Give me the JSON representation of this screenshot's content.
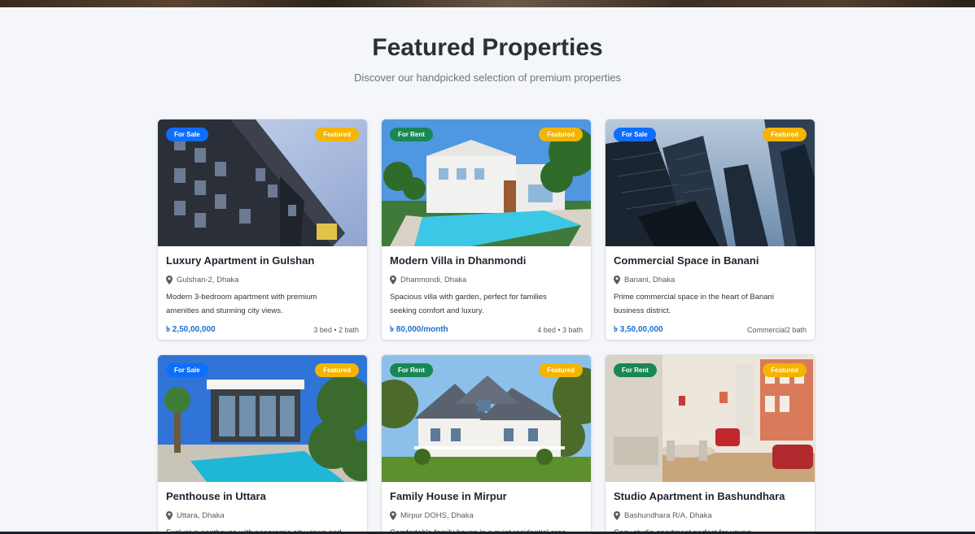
{
  "section": {
    "title": "Featured Properties",
    "subtitle": "Discover our handpicked selection of premium properties"
  },
  "colors": {
    "sale": "#0d6efd",
    "rent": "#198754",
    "featured": "#f4b400",
    "price": "#1a6fd1"
  },
  "properties": [
    {
      "type": "For Sale",
      "featured": "Featured",
      "title": "Luxury Apartment in Gulshan",
      "location": "Gulshan-2, Dhaka",
      "description_l1": "Modern 3-bedroom apartment with premium",
      "description_l2": "amenities and stunning city views.",
      "price": "৳ 2,50,00,000",
      "meta": "3 bed • 2 bath",
      "image": "apartment-building"
    },
    {
      "type": "For Rent",
      "featured": "Featured",
      "title": "Modern Villa in Dhanmondi",
      "location": "Dhanmondi, Dhaka",
      "description_l1": "Spacious villa with garden, perfect for families",
      "description_l2": "seeking comfort and luxury.",
      "price": "৳ 80,000/month",
      "meta": "4 bed • 3 bath",
      "image": "villa-with-pool"
    },
    {
      "type": "For Sale",
      "featured": "Featured",
      "title": "Commercial Space in Banani",
      "location": "Banani, Dhaka",
      "description_l1": "Prime commercial space in the heart of Banani",
      "description_l2": "business district.",
      "price": "৳ 3,50,00,000",
      "meta": "Commercial2 bath",
      "image": "skyscrapers"
    },
    {
      "type": "For Sale",
      "featured": "Featured",
      "title": "Penthouse in Uttara",
      "location": "Uttara, Dhaka",
      "description_l1": "Exclusive penthouse with panoramic city views and",
      "description_l2": "",
      "price": "",
      "meta": "",
      "image": "penthouse-pool"
    },
    {
      "type": "For Rent",
      "featured": "Featured",
      "title": "Family House in Mirpur",
      "location": "Mirpur DOHS, Dhaka",
      "description_l1": "Comfortable family house in a quiet residential area",
      "description_l2": "",
      "price": "",
      "meta": "",
      "image": "family-house"
    },
    {
      "type": "For Rent",
      "featured": "Featured",
      "title": "Studio Apartment in Bashundhara",
      "location": "Bashundhara R/A, Dhaka",
      "description_l1": "Cozy studio apartment perfect for young",
      "description_l2": "",
      "price": "",
      "meta": "",
      "image": "studio-interior"
    }
  ]
}
